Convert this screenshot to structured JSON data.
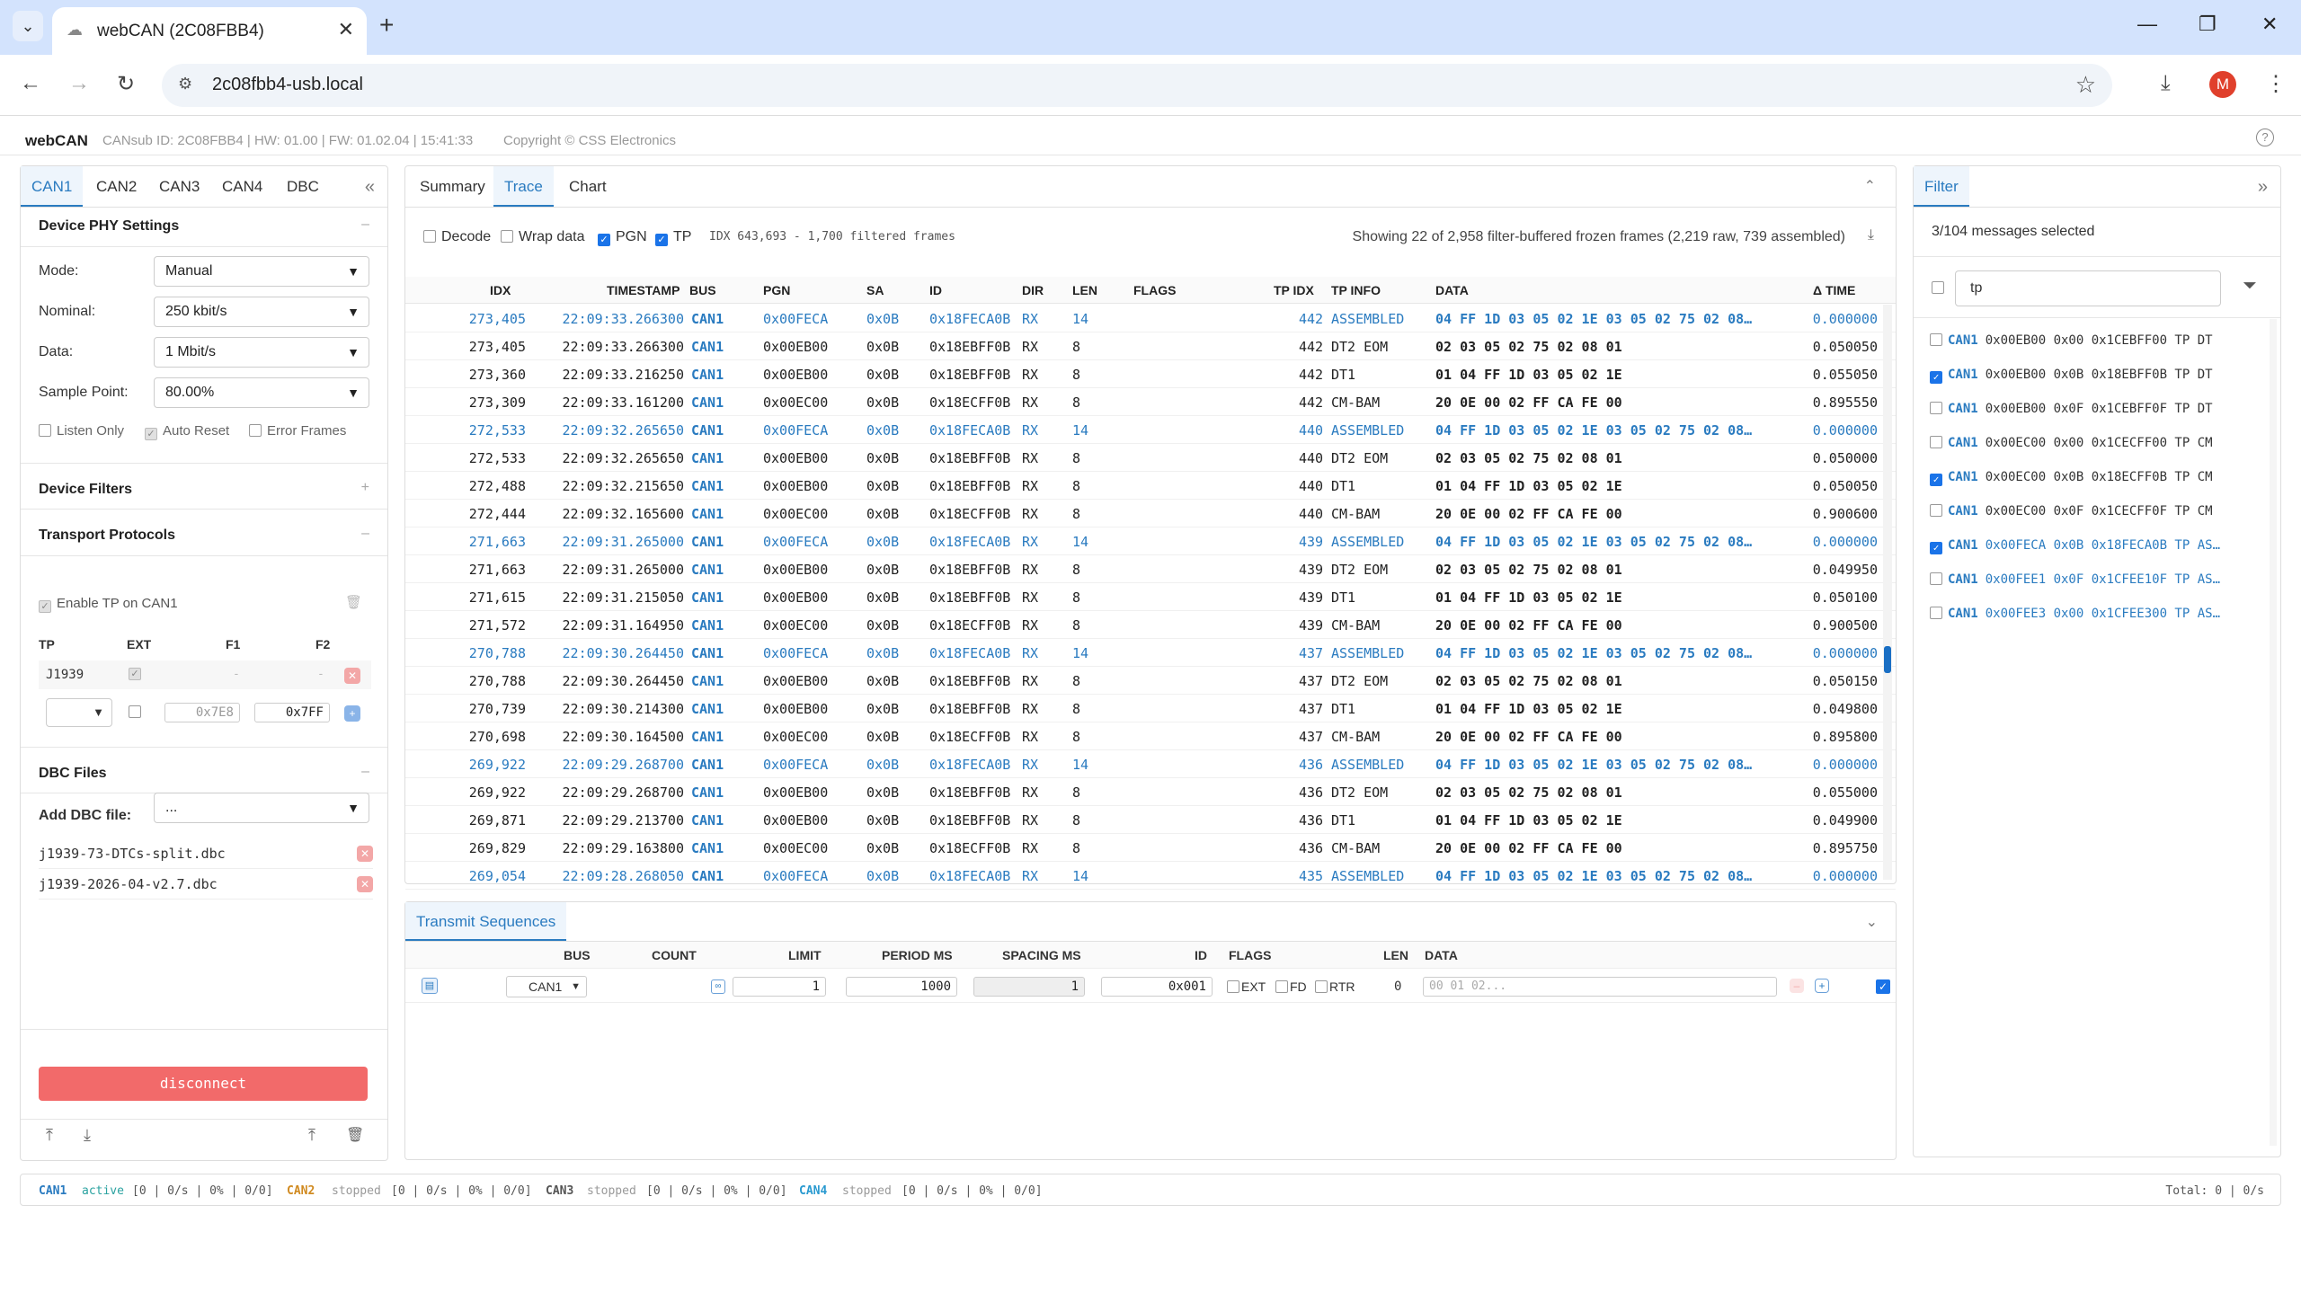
{
  "browser": {
    "tab_title": "webCAN (2C08FBB4)",
    "url": "2c08fbb4-usb.local",
    "avatar_letter": "M"
  },
  "app": {
    "brand": "webCAN",
    "meta": "CANsub ID: 2C08FBB4 | HW: 01.00 | FW: 01.02.04 | 15:41:33",
    "copyright": "Copyright © CSS Electronics"
  },
  "left": {
    "tabs": [
      "CAN1",
      "CAN2",
      "CAN3",
      "CAN4",
      "DBC"
    ],
    "phy_title": "Device PHY Settings",
    "mode_label": "Mode:",
    "mode_value": "Manual",
    "nominal_label": "Nominal:",
    "nominal_value": "250 kbit/s",
    "data_label": "Data:",
    "data_value": "1 Mbit/s",
    "sp_label": "Sample Point:",
    "sp_value": "80.00%",
    "listen_only": "Listen Only",
    "auto_reset": "Auto Reset",
    "error_frames": "Error Frames",
    "filters_title": "Device Filters",
    "tp_title": "Transport Protocols",
    "enable_tp": "Enable TP on CAN1",
    "tp_cols": [
      "TP",
      "EXT",
      "F1",
      "F2"
    ],
    "tp_row_name": "J1939",
    "tp_row_f1": "-",
    "tp_row_f2": "-",
    "tp_new_f1": "0x7E8",
    "tp_new_f2": "0x7FF",
    "dbc_title": "DBC Files",
    "add_dbc_label": "Add DBC file:",
    "add_dbc_value": "...",
    "dbc_files": [
      "j1939-73-DTCs-split.dbc",
      "j1939-2026-04-v2.7.dbc"
    ],
    "disconnect": "disconnect"
  },
  "center": {
    "tabs": [
      "Summary",
      "Trace",
      "Chart"
    ],
    "opt_decode": "Decode",
    "opt_wrap": "Wrap data",
    "opt_pgn": "PGN",
    "opt_tp": "TP",
    "idx_info": "IDX 643,693 - 1,700 filtered frames",
    "showing": "Showing 22 of 2,958 filter-buffered frozen frames (2,219 raw, 739 assembled)",
    "columns": [
      "IDX",
      "TIMESTAMP",
      "BUS",
      "PGN",
      "SA",
      "ID",
      "DIR",
      "LEN",
      "FLAGS",
      "TP IDX",
      "TP INFO",
      "DATA",
      "Δ TIME"
    ],
    "rows": [
      {
        "idx": "273,405",
        "ts": "22:09:33.266300",
        "bus": "CAN1",
        "pgn": "0x00FECA",
        "sa": "0x0B",
        "id": "0x18FECA0B",
        "dir": "RX",
        "len": "14",
        "tpidx": "442",
        "tpinfo": "ASSEMBLED",
        "data": "04 FF 1D 03 05 02 1E 03 05 02 75 02 08…",
        "dt": "0.000000",
        "asm": true
      },
      {
        "idx": "273,405",
        "ts": "22:09:33.266300",
        "bus": "CAN1",
        "pgn": "0x00EB00",
        "sa": "0x0B",
        "id": "0x18EBFF0B",
        "dir": "RX",
        "len": "8",
        "tpidx": "442",
        "tpinfo": "DT2 EOM",
        "data": "02 03 05 02 75 02 08 01",
        "dt": "0.050050",
        "asm": false
      },
      {
        "idx": "273,360",
        "ts": "22:09:33.216250",
        "bus": "CAN1",
        "pgn": "0x00EB00",
        "sa": "0x0B",
        "id": "0x18EBFF0B",
        "dir": "RX",
        "len": "8",
        "tpidx": "442",
        "tpinfo": "DT1",
        "data": "01 04 FF 1D 03 05 02 1E",
        "dt": "0.055050",
        "asm": false
      },
      {
        "idx": "273,309",
        "ts": "22:09:33.161200",
        "bus": "CAN1",
        "pgn": "0x00EC00",
        "sa": "0x0B",
        "id": "0x18ECFF0B",
        "dir": "RX",
        "len": "8",
        "tpidx": "442",
        "tpinfo": "CM-BAM",
        "data": "20 0E 00 02 FF CA FE 00",
        "dt": "0.895550",
        "asm": false
      },
      {
        "idx": "272,533",
        "ts": "22:09:32.265650",
        "bus": "CAN1",
        "pgn": "0x00FECA",
        "sa": "0x0B",
        "id": "0x18FECA0B",
        "dir": "RX",
        "len": "14",
        "tpidx": "440",
        "tpinfo": "ASSEMBLED",
        "data": "04 FF 1D 03 05 02 1E 03 05 02 75 02 08…",
        "dt": "0.000000",
        "asm": true
      },
      {
        "idx": "272,533",
        "ts": "22:09:32.265650",
        "bus": "CAN1",
        "pgn": "0x00EB00",
        "sa": "0x0B",
        "id": "0x18EBFF0B",
        "dir": "RX",
        "len": "8",
        "tpidx": "440",
        "tpinfo": "DT2 EOM",
        "data": "02 03 05 02 75 02 08 01",
        "dt": "0.050000",
        "asm": false
      },
      {
        "idx": "272,488",
        "ts": "22:09:32.215650",
        "bus": "CAN1",
        "pgn": "0x00EB00",
        "sa": "0x0B",
        "id": "0x18EBFF0B",
        "dir": "RX",
        "len": "8",
        "tpidx": "440",
        "tpinfo": "DT1",
        "data": "01 04 FF 1D 03 05 02 1E",
        "dt": "0.050050",
        "asm": false
      },
      {
        "idx": "272,444",
        "ts": "22:09:32.165600",
        "bus": "CAN1",
        "pgn": "0x00EC00",
        "sa": "0x0B",
        "id": "0x18ECFF0B",
        "dir": "RX",
        "len": "8",
        "tpidx": "440",
        "tpinfo": "CM-BAM",
        "data": "20 0E 00 02 FF CA FE 00",
        "dt": "0.900600",
        "asm": false
      },
      {
        "idx": "271,663",
        "ts": "22:09:31.265000",
        "bus": "CAN1",
        "pgn": "0x00FECA",
        "sa": "0x0B",
        "id": "0x18FECA0B",
        "dir": "RX",
        "len": "14",
        "tpidx": "439",
        "tpinfo": "ASSEMBLED",
        "data": "04 FF 1D 03 05 02 1E 03 05 02 75 02 08…",
        "dt": "0.000000",
        "asm": true
      },
      {
        "idx": "271,663",
        "ts": "22:09:31.265000",
        "bus": "CAN1",
        "pgn": "0x00EB00",
        "sa": "0x0B",
        "id": "0x18EBFF0B",
        "dir": "RX",
        "len": "8",
        "tpidx": "439",
        "tpinfo": "DT2 EOM",
        "data": "02 03 05 02 75 02 08 01",
        "dt": "0.049950",
        "asm": false
      },
      {
        "idx": "271,615",
        "ts": "22:09:31.215050",
        "bus": "CAN1",
        "pgn": "0x00EB00",
        "sa": "0x0B",
        "id": "0x18EBFF0B",
        "dir": "RX",
        "len": "8",
        "tpidx": "439",
        "tpinfo": "DT1",
        "data": "01 04 FF 1D 03 05 02 1E",
        "dt": "0.050100",
        "asm": false
      },
      {
        "idx": "271,572",
        "ts": "22:09:31.164950",
        "bus": "CAN1",
        "pgn": "0x00EC00",
        "sa": "0x0B",
        "id": "0x18ECFF0B",
        "dir": "RX",
        "len": "8",
        "tpidx": "439",
        "tpinfo": "CM-BAM",
        "data": "20 0E 00 02 FF CA FE 00",
        "dt": "0.900500",
        "asm": false
      },
      {
        "idx": "270,788",
        "ts": "22:09:30.264450",
        "bus": "CAN1",
        "pgn": "0x00FECA",
        "sa": "0x0B",
        "id": "0x18FECA0B",
        "dir": "RX",
        "len": "14",
        "tpidx": "437",
        "tpinfo": "ASSEMBLED",
        "data": "04 FF 1D 03 05 02 1E 03 05 02 75 02 08…",
        "dt": "0.000000",
        "asm": true
      },
      {
        "idx": "270,788",
        "ts": "22:09:30.264450",
        "bus": "CAN1",
        "pgn": "0x00EB00",
        "sa": "0x0B",
        "id": "0x18EBFF0B",
        "dir": "RX",
        "len": "8",
        "tpidx": "437",
        "tpinfo": "DT2 EOM",
        "data": "02 03 05 02 75 02 08 01",
        "dt": "0.050150",
        "asm": false
      },
      {
        "idx": "270,739",
        "ts": "22:09:30.214300",
        "bus": "CAN1",
        "pgn": "0x00EB00",
        "sa": "0x0B",
        "id": "0x18EBFF0B",
        "dir": "RX",
        "len": "8",
        "tpidx": "437",
        "tpinfo": "DT1",
        "data": "01 04 FF 1D 03 05 02 1E",
        "dt": "0.049800",
        "asm": false
      },
      {
        "idx": "270,698",
        "ts": "22:09:30.164500",
        "bus": "CAN1",
        "pgn": "0x00EC00",
        "sa": "0x0B",
        "id": "0x18ECFF0B",
        "dir": "RX",
        "len": "8",
        "tpidx": "437",
        "tpinfo": "CM-BAM",
        "data": "20 0E 00 02 FF CA FE 00",
        "dt": "0.895800",
        "asm": false
      },
      {
        "idx": "269,922",
        "ts": "22:09:29.268700",
        "bus": "CAN1",
        "pgn": "0x00FECA",
        "sa": "0x0B",
        "id": "0x18FECA0B",
        "dir": "RX",
        "len": "14",
        "tpidx": "436",
        "tpinfo": "ASSEMBLED",
        "data": "04 FF 1D 03 05 02 1E 03 05 02 75 02 08…",
        "dt": "0.000000",
        "asm": true
      },
      {
        "idx": "269,922",
        "ts": "22:09:29.268700",
        "bus": "CAN1",
        "pgn": "0x00EB00",
        "sa": "0x0B",
        "id": "0x18EBFF0B",
        "dir": "RX",
        "len": "8",
        "tpidx": "436",
        "tpinfo": "DT2 EOM",
        "data": "02 03 05 02 75 02 08 01",
        "dt": "0.055000",
        "asm": false
      },
      {
        "idx": "269,871",
        "ts": "22:09:29.213700",
        "bus": "CAN1",
        "pgn": "0x00EB00",
        "sa": "0x0B",
        "id": "0x18EBFF0B",
        "dir": "RX",
        "len": "8",
        "tpidx": "436",
        "tpinfo": "DT1",
        "data": "01 04 FF 1D 03 05 02 1E",
        "dt": "0.049900",
        "asm": false
      },
      {
        "idx": "269,829",
        "ts": "22:09:29.163800",
        "bus": "CAN1",
        "pgn": "0x00EC00",
        "sa": "0x0B",
        "id": "0x18ECFF0B",
        "dir": "RX",
        "len": "8",
        "tpidx": "436",
        "tpinfo": "CM-BAM",
        "data": "20 0E 00 02 FF CA FE 00",
        "dt": "0.895750",
        "asm": false
      },
      {
        "idx": "269,054",
        "ts": "22:09:28.268050",
        "bus": "CAN1",
        "pgn": "0x00FECA",
        "sa": "0x0B",
        "id": "0x18FECA0B",
        "dir": "RX",
        "len": "14",
        "tpidx": "435",
        "tpinfo": "ASSEMBLED",
        "data": "04 FF 1D 03 05 02 1E 03 05 02 75 02 08…",
        "dt": "0.000000",
        "asm": true
      }
    ]
  },
  "transmit": {
    "title": "Transmit Sequences",
    "columns": [
      "BUS",
      "COUNT",
      "LIMIT",
      "PERIOD MS",
      "SPACING MS",
      "ID",
      "FLAGS",
      "LEN",
      "DATA"
    ],
    "bus": "CAN1",
    "limit": "1",
    "period": "1000",
    "spacing": "1",
    "id": "0x001",
    "ext": "EXT",
    "fd": "FD",
    "rtr": "RTR",
    "len": "0",
    "data_placeholder": "00 01 02..."
  },
  "filter": {
    "tab": "Filter",
    "selected": "3/104 messages selected",
    "search": "tp",
    "items": [
      {
        "checked": false,
        "bus": "CAN1",
        "text": "0x00EB00 0x00 0x1CEBFF00 TP DT"
      },
      {
        "checked": true,
        "bus": "CAN1",
        "text": "0x00EB00 0x0B 0x18EBFF0B TP DT"
      },
      {
        "checked": false,
        "bus": "CAN1",
        "text": "0x00EB00 0x0F 0x1CEBFF0F TP DT"
      },
      {
        "checked": false,
        "bus": "CAN1",
        "text": "0x00EC00 0x00 0x1CECFF00 TP CM"
      },
      {
        "checked": true,
        "bus": "CAN1",
        "text": "0x00EC00 0x0B 0x18ECFF0B TP CM"
      },
      {
        "checked": false,
        "bus": "CAN1",
        "text": "0x00EC00 0x0F 0x1CECFF0F TP CM"
      },
      {
        "checked": true,
        "bus": "CAN1",
        "text": "0x00FECA 0x0B 0x18FECA0B TP AS…"
      },
      {
        "checked": false,
        "bus": "CAN1",
        "text": "0x00FEE1 0x0F 0x1CFEE10F TP AS…"
      },
      {
        "checked": false,
        "bus": "CAN1",
        "text": "0x00FEE3 0x00 0x1CFEE300 TP AS…"
      }
    ]
  },
  "status": {
    "can1": "CAN1",
    "can1_state": "active",
    "can1_stats": "[0 | 0/s | 0% | 0/0]",
    "can2": "CAN2",
    "can2_state": "stopped",
    "can2_stats": "[0 | 0/s | 0% | 0/0]",
    "can3": "CAN3",
    "can3_state": "stopped",
    "can3_stats": "[0 | 0/s | 0% | 0/0]",
    "can4": "CAN4",
    "can4_state": "stopped",
    "can4_stats": "[0 | 0/s | 0% | 0/0]",
    "total": "Total: 0 | 0/s"
  },
  "colors": {
    "accent": "#2a7bc0",
    "danger": "#f26a6a",
    "browser_bar": "#d3e3fd"
  }
}
